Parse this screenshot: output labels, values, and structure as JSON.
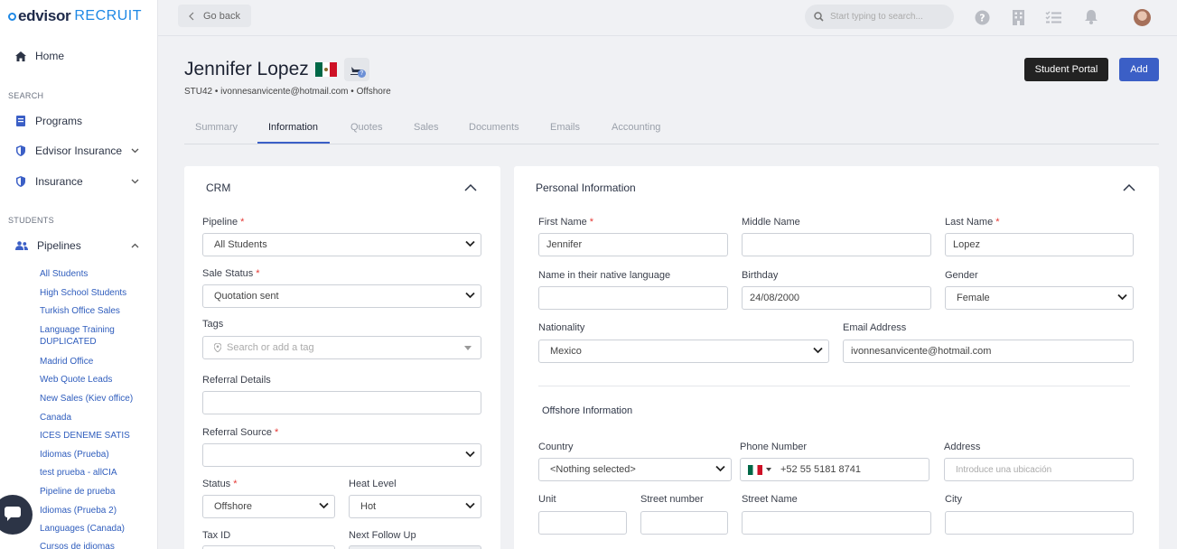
{
  "brand": {
    "edvisor": "edvisor",
    "recruit": "RECRUIT"
  },
  "sidebar": {
    "home": "Home",
    "search_label": "SEARCH",
    "programs": "Programs",
    "edvisor_insurance": "Edvisor Insurance",
    "insurance": "Insurance",
    "students_label": "STUDENTS",
    "pipelines": "Pipelines",
    "pipeline_items": [
      "All Students",
      "High School Students",
      "Turkish Office Sales",
      "Language Training DUPLICATED",
      "Madrid Office",
      "Web Quote Leads",
      "New Sales (Kiev office)",
      "Canada",
      "ICES DENEME SATIS",
      "Idiomas (Prueba)",
      "test prueba - allCIA",
      "Pipeline de prueba",
      "Idiomas (Prueba 2)",
      "Languages (Canada)",
      "Cursos de idiomas"
    ]
  },
  "topbar": {
    "back": "Go back",
    "search_placeholder": "Start typing to search..."
  },
  "student": {
    "name": "Jennifer Lopez",
    "subtitle": "STU42 • ivonnesanvicente@hotmail.com • Offshore",
    "flight_badge": "?"
  },
  "actions": {
    "portal": "Student Portal",
    "add": "Add"
  },
  "tabs": [
    "Summary",
    "Information",
    "Quotes",
    "Sales",
    "Documents",
    "Emails",
    "Accounting"
  ],
  "crm": {
    "title": "CRM",
    "pipeline_label": "Pipeline",
    "pipeline_value": "All Students",
    "sale_status_label": "Sale Status",
    "sale_status_value": "Quotation sent",
    "tags_label": "Tags",
    "tags_placeholder": "Search or add a tag",
    "referral_details_label": "Referral Details",
    "referral_source_label": "Referral Source",
    "status_label": "Status",
    "status_value": "Offshore",
    "heat_label": "Heat Level",
    "heat_value": "Hot",
    "tax_label": "Tax ID",
    "follow_label": "Next Follow Up"
  },
  "personal": {
    "title": "Personal Information",
    "first_name_label": "First Name",
    "first_name": "Jennifer",
    "middle_name_label": "Middle Name",
    "last_name_label": "Last Name",
    "last_name": "Lopez",
    "native_label": "Name in their native language",
    "birthday_label": "Birthday",
    "birthday": "24/08/2000",
    "gender_label": "Gender",
    "gender": "Female",
    "nationality_label": "Nationality",
    "nationality": "Mexico",
    "email_label": "Email Address",
    "email": "ivonnesanvicente@hotmail.com"
  },
  "offshore": {
    "title": "Offshore Information",
    "country_label": "Country",
    "country": "<Nothing selected>",
    "phone_label": "Phone Number",
    "phone": "+52 55 5181 8741",
    "address_label": "Address",
    "address_placeholder": "Introduce una ubicación",
    "unit_label": "Unit",
    "street_number_label": "Street number",
    "street_name_label": "Street Name",
    "city_label": "City"
  }
}
